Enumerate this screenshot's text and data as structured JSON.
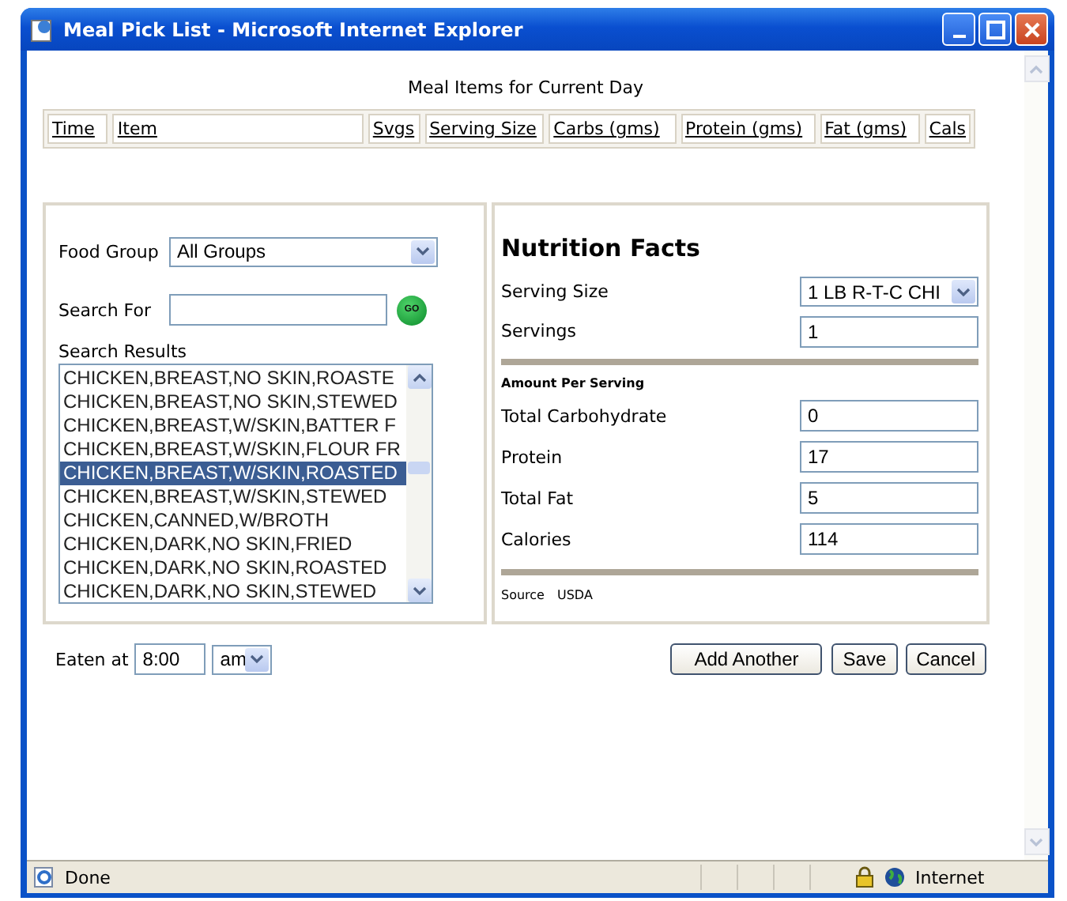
{
  "window": {
    "title": "Meal Pick List - Microsoft Internet Explorer"
  },
  "heading": "Meal Items for Current Day",
  "meal_table": {
    "columns": [
      "Time",
      "Item",
      "Svgs",
      "Serving Size",
      "Carbs (gms)",
      "Protein (gms)",
      "Fat (gms)",
      "Cals"
    ]
  },
  "food_group": {
    "label": "Food Group",
    "value": "All Groups"
  },
  "search": {
    "label": "Search For",
    "button": "GO"
  },
  "search_results": {
    "label": "Search Results",
    "items": [
      {
        "text": "CHICKEN,BREAST,NO SKIN,ROASTE",
        "selected": false
      },
      {
        "text": "CHICKEN,BREAST,NO SKIN,STEWED",
        "selected": false
      },
      {
        "text": "CHICKEN,BREAST,W/SKIN,BATTER F",
        "selected": false
      },
      {
        "text": "CHICKEN,BREAST,W/SKIN,FLOUR FR",
        "selected": false
      },
      {
        "text": "CHICKEN,BREAST,W/SKIN,ROASTED",
        "selected": true
      },
      {
        "text": "CHICKEN,BREAST,W/SKIN,STEWED",
        "selected": false
      },
      {
        "text": "CHICKEN,CANNED,W/BROTH",
        "selected": false
      },
      {
        "text": "CHICKEN,DARK,NO SKIN,FRIED",
        "selected": false
      },
      {
        "text": "CHICKEN,DARK,NO SKIN,ROASTED",
        "selected": false
      },
      {
        "text": "CHICKEN,DARK,NO SKIN,STEWED",
        "selected": false
      }
    ]
  },
  "nutrition": {
    "title": "Nutrition Facts",
    "serving_size": {
      "label": "Serving Size",
      "value": "1 LB R-T-C CHI"
    },
    "servings": {
      "label": "Servings",
      "value": "1"
    },
    "amount_label": "Amount Per Serving",
    "nutrients": [
      {
        "label": "Total Carbohydrate",
        "value": "0"
      },
      {
        "label": "Protein",
        "value": "17"
      },
      {
        "label": "Total Fat",
        "value": "5"
      },
      {
        "label": "Calories",
        "value": "114"
      }
    ],
    "source": {
      "label": "Source",
      "value": "USDA"
    }
  },
  "eaten_at": {
    "label": "Eaten at",
    "time": "8:00",
    "period": "am"
  },
  "buttons": [
    "Add Another",
    "Save",
    "Cancel"
  ],
  "status_bar": {
    "text": "Done",
    "zone": "Internet"
  }
}
